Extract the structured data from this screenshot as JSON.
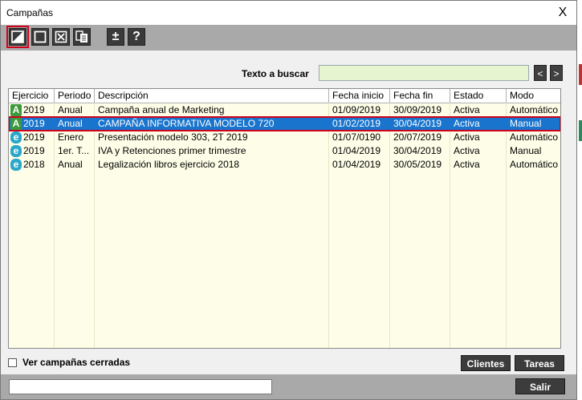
{
  "window": {
    "title": "Campañas",
    "close_glyph": "X"
  },
  "toolbar": {
    "buttons": [
      {
        "name": "new-campaign-button",
        "icon": "new-icon"
      },
      {
        "name": "blank-button",
        "icon": "square-icon"
      },
      {
        "name": "delete-button",
        "icon": "x-box-icon"
      },
      {
        "name": "copy-button",
        "icon": "copy-icon"
      },
      {
        "name": "plus-minus-button",
        "icon": "plus-minus-icon",
        "glyph": "±"
      },
      {
        "name": "help-button",
        "icon": "help-icon",
        "glyph": "?"
      }
    ]
  },
  "search": {
    "label": "Texto a buscar",
    "value": "",
    "prev": "<",
    "next": ">"
  },
  "table": {
    "columns": [
      "Ejercicio",
      "Periodo",
      "Descripción",
      "Fecha inicio",
      "Fecha fin",
      "Estado",
      "Modo"
    ],
    "rows": [
      {
        "icon": "A",
        "ejercicio": "2019",
        "periodo": "Anual",
        "descripcion": "Campaña anual de Marketing",
        "inicio": "01/09/2019",
        "fin": "30/09/2019",
        "estado": "Activa",
        "modo": "Automático"
      },
      {
        "icon": "A",
        "ejercicio": "2019",
        "periodo": "Anual",
        "descripcion": "CAMPAÑA INFORMATIVA MODELO 720",
        "inicio": "01/02/2019",
        "fin": "30/04/2019",
        "estado": "Activa",
        "modo": "Manual",
        "selected": true
      },
      {
        "icon": "e",
        "ejercicio": "2019",
        "periodo": "Enero",
        "descripcion": "Presentación modelo 303, 2T 2019",
        "inicio": "01/07/0190",
        "fin": "20/07/2019",
        "estado": "Activa",
        "modo": "Automático"
      },
      {
        "icon": "e",
        "ejercicio": "2019",
        "periodo": "1er. T...",
        "descripcion": "IVA y Retenciones primer trimestre",
        "inicio": "01/04/2019",
        "fin": "30/04/2019",
        "estado": "Activa",
        "modo": "Manual"
      },
      {
        "icon": "e",
        "ejercicio": "2018",
        "periodo": "Anual",
        "descripcion": "Legalización libros ejercicio 2018",
        "inicio": "01/04/2019",
        "fin": "30/05/2019",
        "estado": "Activa",
        "modo": "Automático"
      }
    ]
  },
  "options": {
    "closed_label": "Ver campañas cerradas",
    "closed_checked": false
  },
  "buttons": {
    "clientes": "Clientes",
    "tareas": "Tareas",
    "salir": "Salir"
  },
  "footer": {
    "input_value": ""
  }
}
